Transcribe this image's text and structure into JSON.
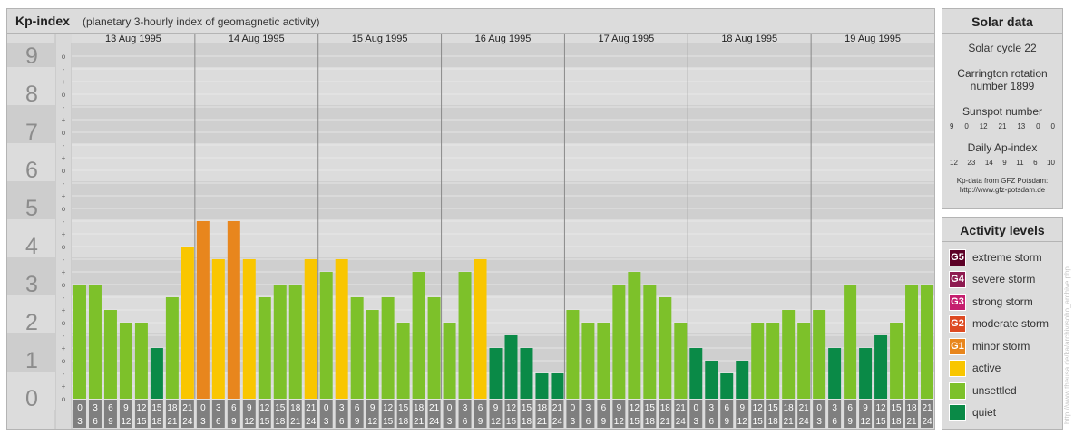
{
  "header": {
    "title": "Kp-index",
    "subtitle": "(planetary 3-hourly index of geomagnetic activity)"
  },
  "solar": {
    "heading": "Solar data",
    "cycle": "Solar cycle 22",
    "carrington_line1": "Carrington rotation",
    "carrington_line2": "number 1899",
    "sunspot_label": "Sunspot number",
    "sunspot_values": [
      "9",
      "0",
      "12",
      "21",
      "13",
      "0",
      "0"
    ],
    "ap_label": "Daily Ap-index",
    "ap_values": [
      "12",
      "23",
      "14",
      "9",
      "11",
      "6",
      "10"
    ],
    "source_line1": "Kp-data from GFZ Potsdam:",
    "source_line2": "http://www.gfz-potsdam.de"
  },
  "activity": {
    "heading": "Activity levels",
    "levels": [
      {
        "code": "G5",
        "label": "extreme storm",
        "color": "#5c0026"
      },
      {
        "code": "G4",
        "label": "severe storm",
        "color": "#8e1a50"
      },
      {
        "code": "G3",
        "label": "strong storm",
        "color": "#c51e6e"
      },
      {
        "code": "G2",
        "label": "moderate storm",
        "color": "#dd4a22"
      },
      {
        "code": "G1",
        "label": "minor storm",
        "color": "#e8861d"
      },
      {
        "code": "",
        "label": "active",
        "color": "#f9c600"
      },
      {
        "code": "",
        "label": "unsettled",
        "color": "#7dc12a"
      },
      {
        "code": "",
        "label": "quiet",
        "color": "#0a8a47"
      }
    ]
  },
  "watermark": "http://www.theusa.de/ka/archiv/soho_archive.php",
  "chart_data": {
    "type": "bar",
    "title": "Kp-index",
    "ylim": [
      0,
      9
    ],
    "y_tick_labels": [
      "0",
      "1",
      "2",
      "3",
      "4",
      "5",
      "6",
      "7",
      "8",
      "9"
    ],
    "y_sub_labels": [
      "o",
      "+",
      "-",
      "o"
    ],
    "days": [
      "13 Aug 1995",
      "14 Aug 1995",
      "15 Aug 1995",
      "16 Aug 1995",
      "17 Aug 1995",
      "18 Aug 1995",
      "19 Aug 1995"
    ],
    "hour_start_labels": [
      "0",
      "3",
      "6",
      "9",
      "12",
      "15",
      "18",
      "21"
    ],
    "hour_end_labels": [
      "3",
      "6",
      "9",
      "12",
      "15",
      "18",
      "21",
      "24"
    ],
    "values": [
      3.0,
      3.0,
      2.333,
      2.0,
      2.0,
      1.333,
      2.667,
      4.0,
      4.667,
      3.667,
      4.667,
      3.667,
      2.667,
      3.0,
      3.0,
      3.667,
      3.333,
      3.667,
      2.667,
      2.333,
      2.667,
      2.0,
      3.333,
      2.667,
      2.0,
      3.333,
      3.667,
      1.333,
      1.667,
      1.333,
      0.667,
      0.667,
      2.333,
      2.0,
      2.0,
      3.0,
      3.333,
      3.0,
      2.667,
      2.0,
      1.333,
      1.0,
      0.667,
      1.0,
      2.0,
      2.0,
      2.333,
      2.0,
      2.333,
      1.333,
      3.0,
      1.333,
      1.667,
      2.0,
      3.0,
      3.0
    ],
    "colors": {
      "quiet": "#0a8a47",
      "unsettled": "#7dc12a",
      "active": "#f9c600",
      "g1": "#e8861d",
      "g2": "#dd4a22"
    },
    "grid": true,
    "legend_position": "right"
  }
}
